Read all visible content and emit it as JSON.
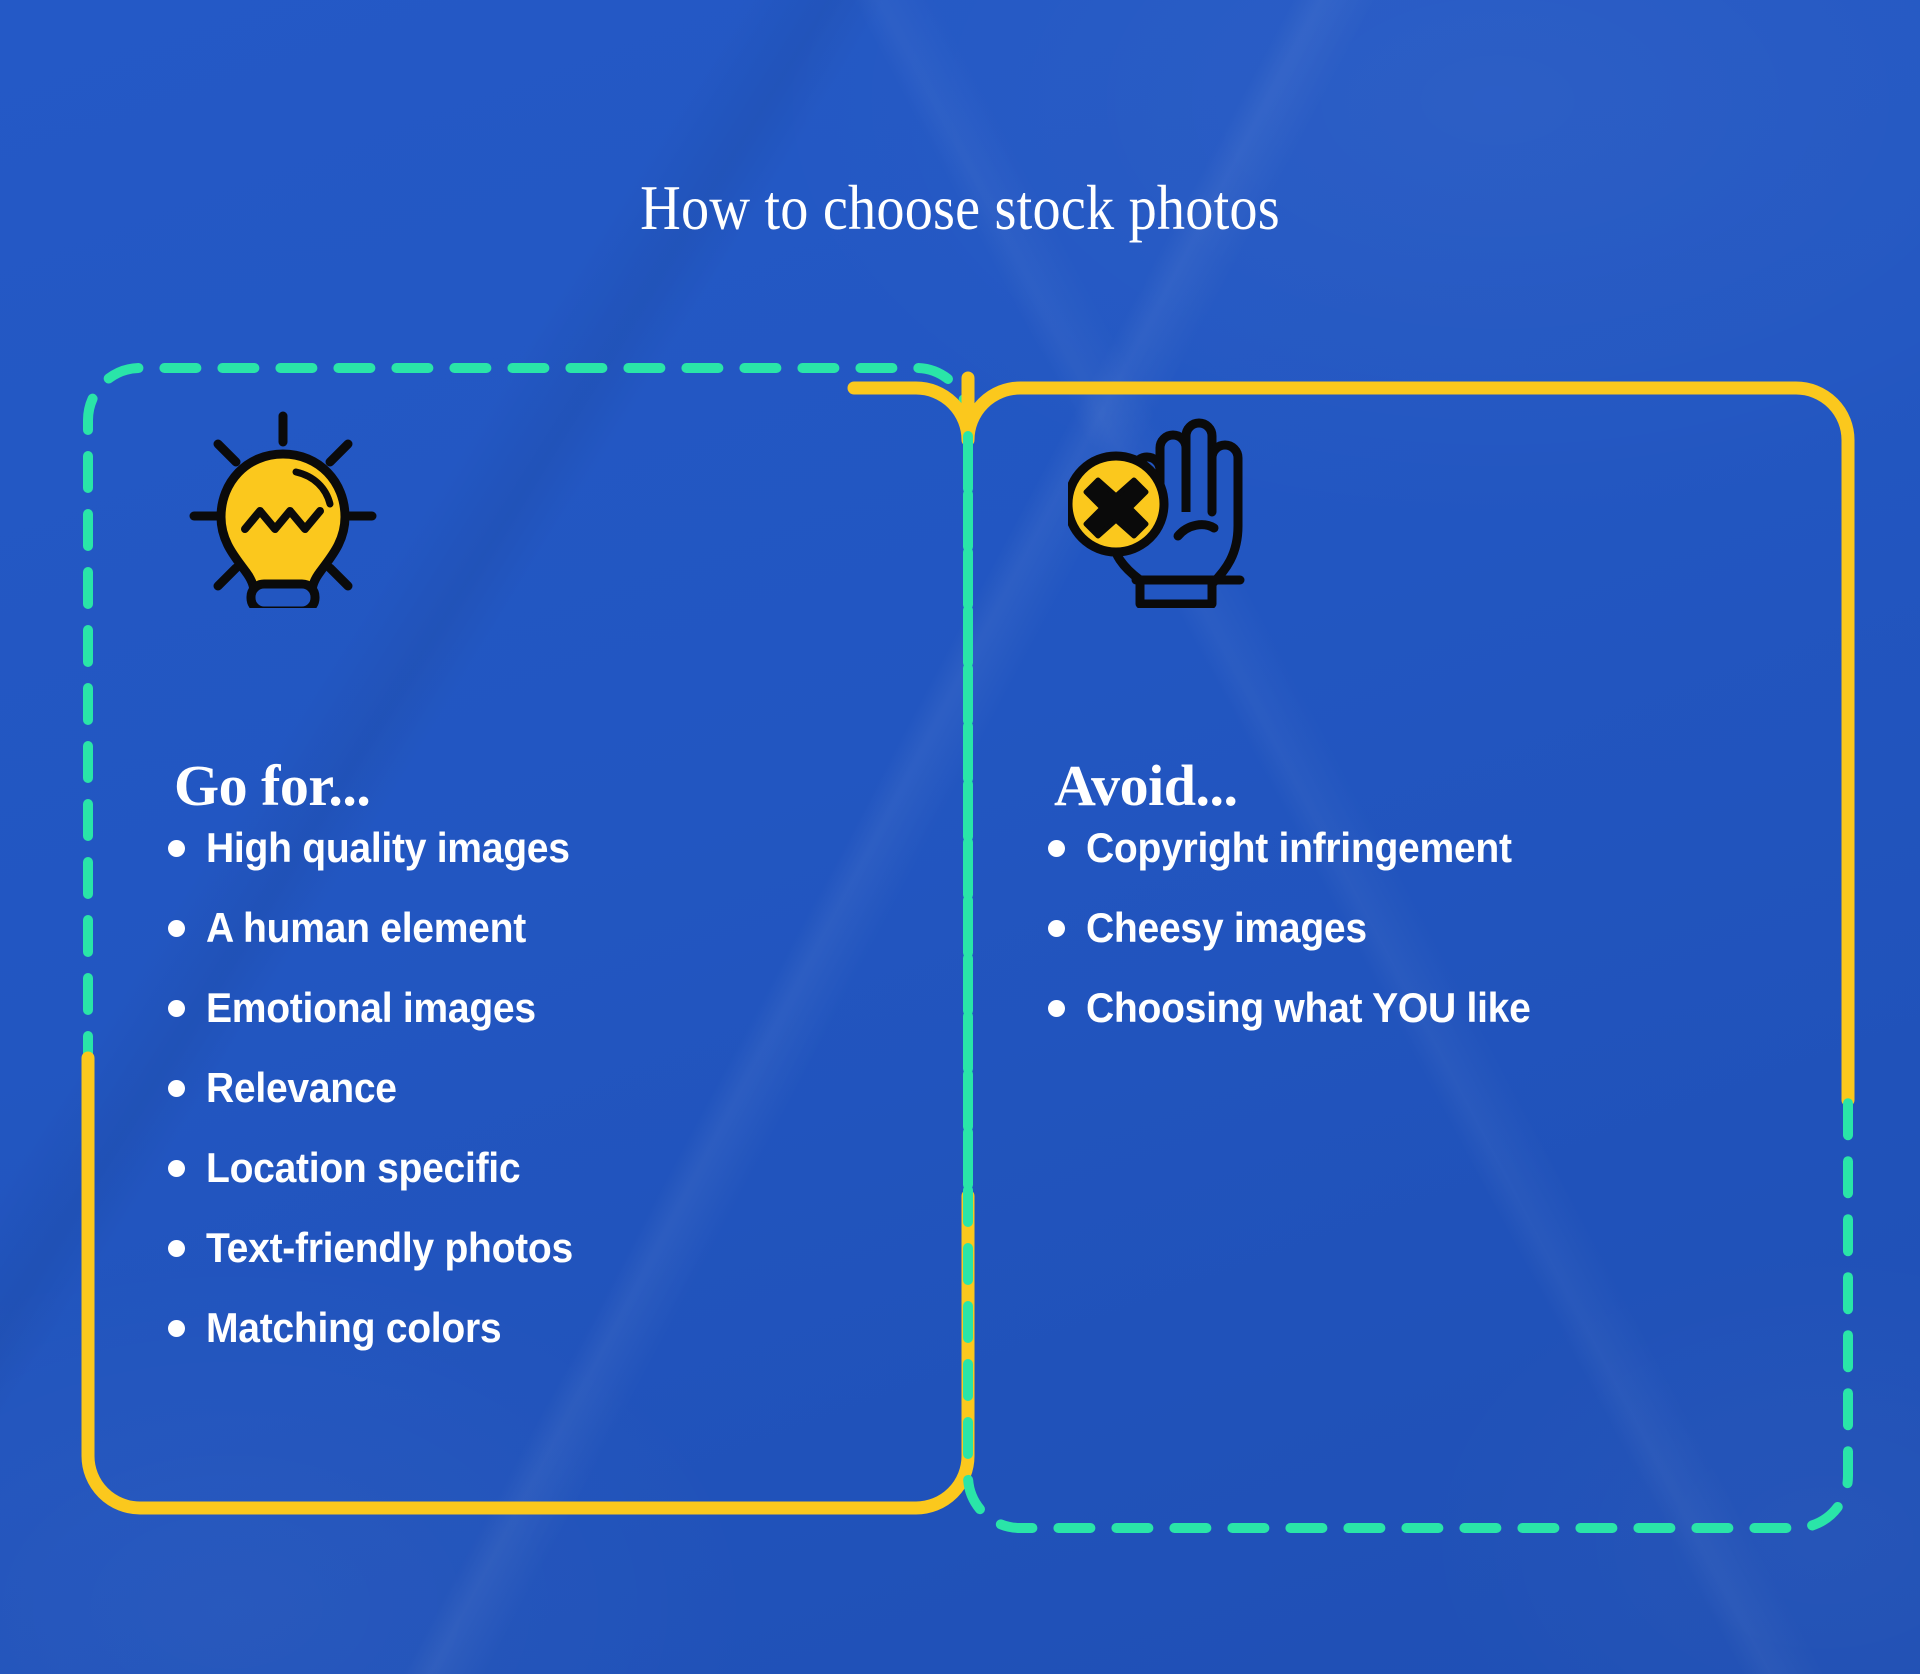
{
  "header": {
    "title": "How to choose stock photos"
  },
  "colors": {
    "background_blue": "#2256c1",
    "accent_green": "#2ae5a8",
    "accent_yellow": "#fbc81d",
    "text_white": "#ffffff",
    "icon_outline": "#0a0a0a"
  },
  "cards": [
    {
      "id": "go-for",
      "heading": "Go for...",
      "icon": "lightbulb-icon",
      "border_top_color": "#2ae5a8",
      "border_bottom_color": "#fbc81d",
      "border_top_style": "dashed",
      "border_bottom_style": "solid",
      "items": [
        "High quality images",
        "A human element",
        "Emotional images",
        "Relevance",
        "Location specific",
        "Text-friendly photos",
        "Matching colors"
      ]
    },
    {
      "id": "avoid",
      "heading": "Avoid...",
      "icon": "stop-hand-icon",
      "border_top_color": "#fbc81d",
      "border_bottom_color": "#2ae5a8",
      "border_top_style": "solid",
      "border_bottom_style": "dashed",
      "items": [
        "Copyright infringement",
        "Cheesy images",
        "Choosing what YOU like"
      ]
    }
  ]
}
